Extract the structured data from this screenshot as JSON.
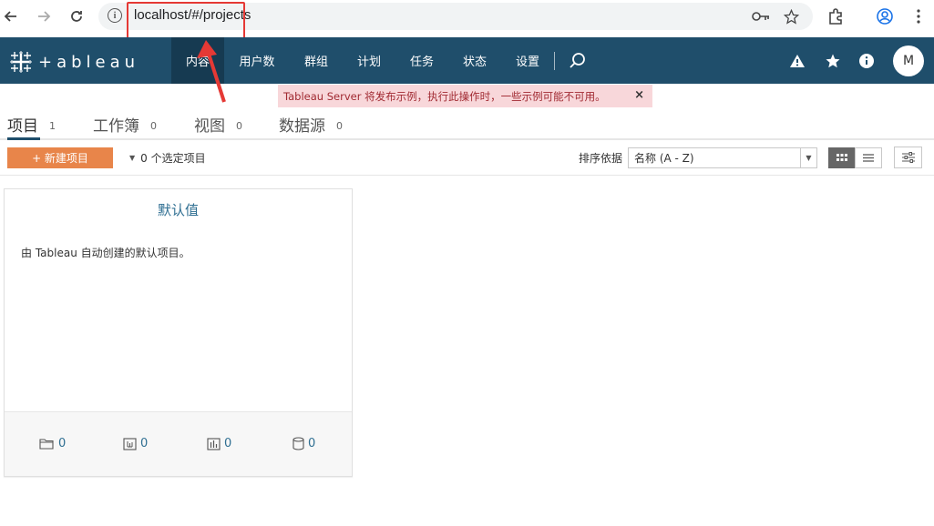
{
  "browser": {
    "url": "localhost/#/projects",
    "icons": [
      "back-arrow-icon",
      "forward-arrow-icon",
      "reload-icon",
      "info-icon",
      "key-icon",
      "star-icon",
      "extensions-icon",
      "profile-icon",
      "kebab-menu-icon"
    ]
  },
  "brand": {
    "logo_text": "+ableau",
    "nav_bg": "#1f4e6b",
    "accent": "#e8854a",
    "link_color": "#2f6f92"
  },
  "nav": {
    "items": [
      {
        "label": "内容"
      },
      {
        "label": "用户数"
      },
      {
        "label": "群组"
      },
      {
        "label": "计划"
      },
      {
        "label": "任务"
      },
      {
        "label": "状态"
      },
      {
        "label": "设置"
      }
    ],
    "avatar": "M"
  },
  "banner": {
    "text": "Tableau Server 将发布示例，执行此操作时，一些示例可能不可用。",
    "close": "×"
  },
  "tabs": [
    {
      "label": "项目",
      "count": "1"
    },
    {
      "label": "工作簿",
      "count": "0"
    },
    {
      "label": "视图",
      "count": "0"
    },
    {
      "label": "数据源",
      "count": "0"
    }
  ],
  "toolbar": {
    "new_project": "+ 新建项目",
    "selected": "0 个选定项目",
    "sort_label": "排序依据",
    "sort_value": "名称 (A - Z)"
  },
  "card": {
    "title": "默认值",
    "description": "由 Tableau 自动创建的默认项目。",
    "stats": [
      {
        "icon": "folder-icon",
        "value": "0"
      },
      {
        "icon": "workbook-icon",
        "value": "0"
      },
      {
        "icon": "view-icon",
        "value": "0"
      },
      {
        "icon": "datasource-icon",
        "value": "0"
      }
    ]
  }
}
